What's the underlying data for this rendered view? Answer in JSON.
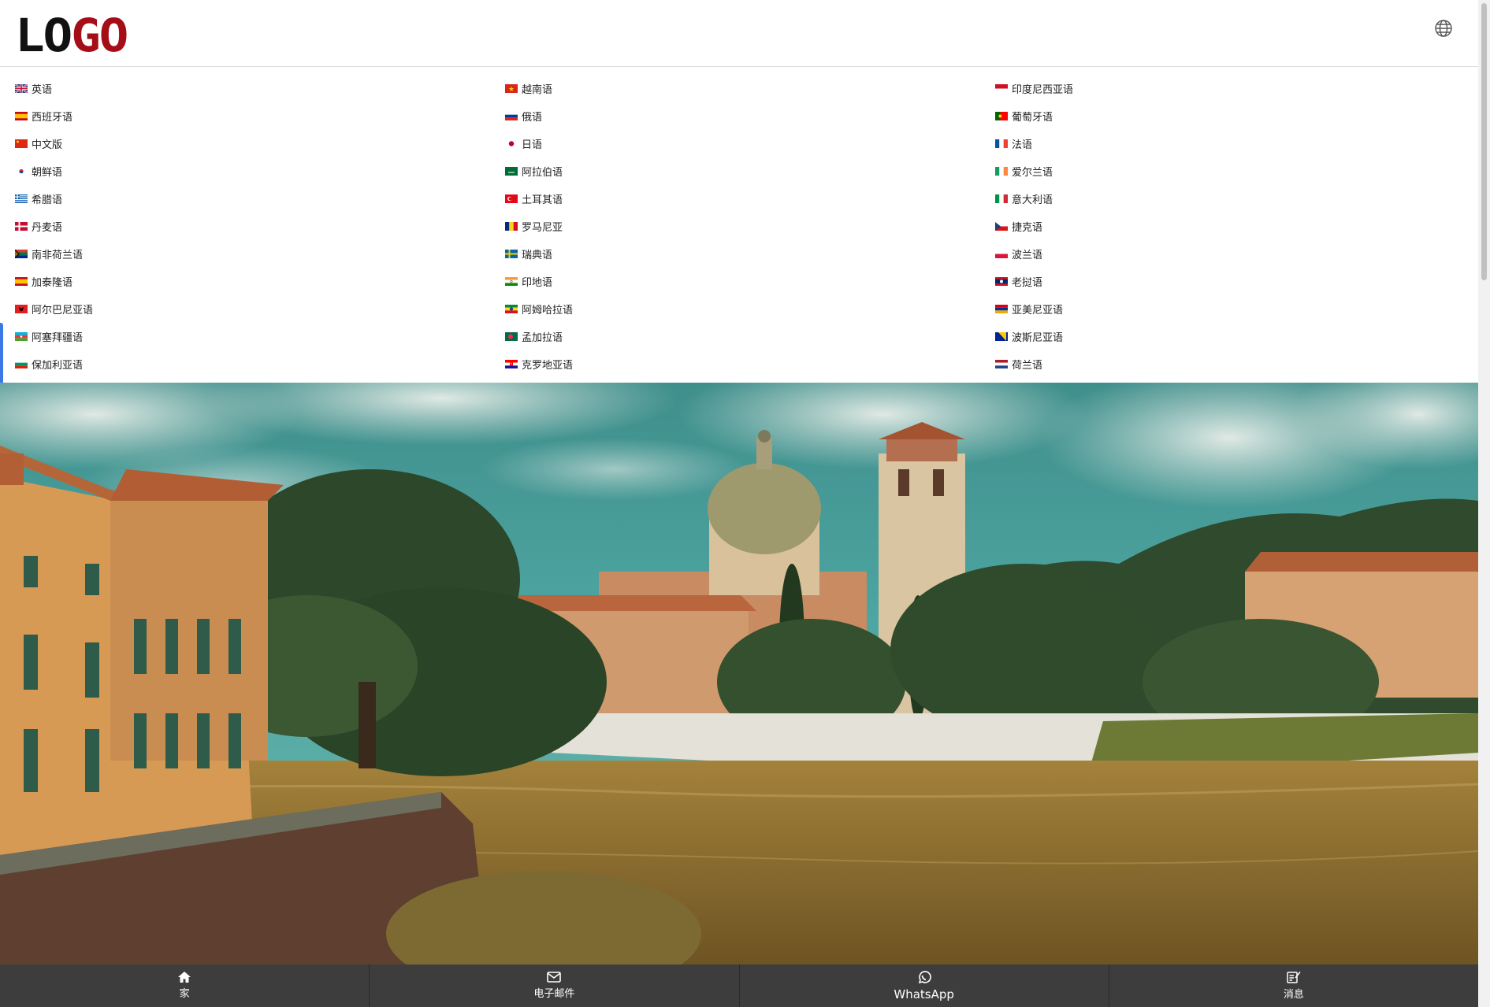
{
  "header": {
    "logo_part1": "LO",
    "logo_part2": "GO",
    "globe_icon": "globe-icon"
  },
  "colors": {
    "logo_dark": "#111111",
    "logo_red": "#a50d17",
    "nav_bar": "#3d3d3d",
    "accent": "#3a78e6"
  },
  "languages": [
    {
      "label": "英语",
      "flag": "uk"
    },
    {
      "label": "越南语",
      "flag": "vn"
    },
    {
      "label": "印度尼西亚语",
      "flag": "id"
    },
    {
      "label": "西班牙语",
      "flag": "es"
    },
    {
      "label": "俄语",
      "flag": "ru"
    },
    {
      "label": "葡萄牙语",
      "flag": "pt"
    },
    {
      "label": "中文版",
      "flag": "cn"
    },
    {
      "label": "日语",
      "flag": "jp"
    },
    {
      "label": "法语",
      "flag": "fr"
    },
    {
      "label": "朝鲜语",
      "flag": "kr"
    },
    {
      "label": "阿拉伯语",
      "flag": "sa"
    },
    {
      "label": "爱尔兰语",
      "flag": "ie"
    },
    {
      "label": "希腊语",
      "flag": "gr"
    },
    {
      "label": "土耳其语",
      "flag": "tr"
    },
    {
      "label": "意大利语",
      "flag": "it"
    },
    {
      "label": "丹麦语",
      "flag": "dk"
    },
    {
      "label": "罗马尼亚",
      "flag": "ro"
    },
    {
      "label": "捷克语",
      "flag": "cz"
    },
    {
      "label": "南非荷兰语",
      "flag": "za"
    },
    {
      "label": "瑞典语",
      "flag": "se"
    },
    {
      "label": "波兰语",
      "flag": "pl"
    },
    {
      "label": "加泰隆语",
      "flag": "es"
    },
    {
      "label": "印地语",
      "flag": "in"
    },
    {
      "label": "老挝语",
      "flag": "la"
    },
    {
      "label": "阿尔巴尼亚语",
      "flag": "al"
    },
    {
      "label": "阿姆哈拉语",
      "flag": "et"
    },
    {
      "label": "亚美尼亚语",
      "flag": "am"
    },
    {
      "label": "阿塞拜疆语",
      "flag": "az"
    },
    {
      "label": "孟加拉语",
      "flag": "bd"
    },
    {
      "label": "波斯尼亚语",
      "flag": "ba"
    },
    {
      "label": "保加利亚语",
      "flag": "bg"
    },
    {
      "label": "克罗地亚语",
      "flag": "hr"
    },
    {
      "label": "荷兰语",
      "flag": "nl"
    }
  ],
  "bottom_nav": [
    {
      "label": "家",
      "icon": "home-icon"
    },
    {
      "label": "电子邮件",
      "icon": "envelope-icon"
    },
    {
      "label": "WhatsApp",
      "icon": "whatsapp-icon"
    },
    {
      "label": "消息",
      "icon": "message-edit-icon"
    }
  ]
}
